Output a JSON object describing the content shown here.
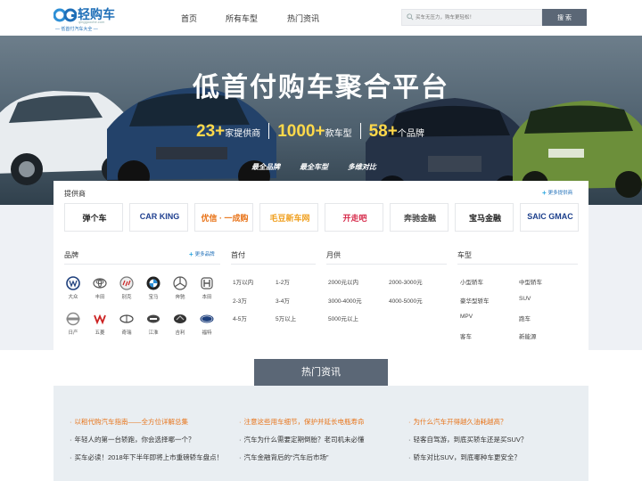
{
  "header": {
    "logo_name": "轻购车",
    "logo_url": "qingguoche.com",
    "logo_slogan": "— 低首付汽车大全 —",
    "nav": [
      "首页",
      "所有车型",
      "热门资讯"
    ],
    "search_placeholder": "买车无压力，购车更轻松！",
    "search_button": "搜 索"
  },
  "banner": {
    "title": "低首付购车聚合平台",
    "stats": [
      {
        "num": "23+",
        "label": "家提供商"
      },
      {
        "num": "1000+",
        "label": "款车型"
      },
      {
        "num": "58+",
        "label": "个品牌"
      }
    ],
    "tags": [
      "最全品牌",
      "最全车型",
      "多维对比"
    ]
  },
  "providers": {
    "title": "提供商",
    "more": "更多提供商",
    "items": [
      {
        "text": "弹个车",
        "color": "#222"
      },
      {
        "text": "CAR KING",
        "color": "#1f3f8f"
      },
      {
        "text": "优信 · 一成购",
        "color": "#e8741a"
      },
      {
        "text": "毛豆新车网",
        "color": "#f0a020"
      },
      {
        "text": "开走吧",
        "color": "#d62a4a"
      },
      {
        "text": "奔驰金融",
        "color": "#444"
      },
      {
        "text": "宝马金融",
        "color": "#222"
      },
      {
        "text": "SAIC GMAC",
        "color": "#1c3f8c"
      }
    ]
  },
  "brands": {
    "title": "品牌",
    "more": "更多品牌",
    "items": [
      "大众",
      "丰田",
      "别克",
      "宝马",
      "奔驰",
      "本田",
      "日产",
      "五菱",
      "奇瑞",
      "江淮",
      "吉利",
      "福特"
    ]
  },
  "downpay": {
    "title": "首付",
    "items": [
      "1万以内",
      "1-2万",
      "2-3万",
      "3-4万",
      "4-5万",
      "5万以上"
    ]
  },
  "monthly": {
    "title": "月供",
    "items": [
      "2000元以内",
      "2000-3000元",
      "3000-4000元",
      "4000-5000元",
      "5000元以上"
    ]
  },
  "cartype": {
    "title": "车型",
    "items": [
      "小型轿车",
      "中型轿车",
      "豪华型轿车",
      "SUV",
      "MPV",
      "跑车",
      "客车",
      "新能源"
    ]
  },
  "hot": {
    "title": "热门资讯",
    "news": [
      [
        "以租代购汽车指南——全方位详解总集",
        "年轻人的第一台轿跑，你会选择哪一个？",
        "买车必读！2018年下半年即将上市重磅轿车盘点！"
      ],
      [
        "注意这些用车细节，保护并延长电瓶寿命",
        "汽车为什么需要定期倒胎？老司机未必懂",
        "汽车金融背后的“汽车后市场”"
      ],
      [
        "为什么汽车开得越久油耗越高？",
        "轻客自驾游，到底买轿车还是买SUV？",
        "轿车对比SUV，到底哪种车更安全？"
      ]
    ]
  },
  "colors": {
    "accent": "#1f6fb8",
    "stat_yellow": "#ffd94a",
    "orange_link": "#e8741a",
    "button": "#5b6776"
  }
}
